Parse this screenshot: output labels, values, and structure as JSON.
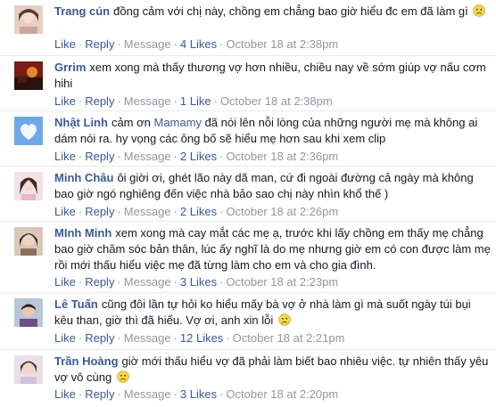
{
  "actions": {
    "like": "Like",
    "reply": "Reply",
    "message": "Message",
    "sep": "·"
  },
  "comments": [
    {
      "author": "Trang cún",
      "text": "đồng cảm với chị này, chồng em chẳng bao giờ hiểu đc em đã làm gì",
      "emoji": "sad-face-emoji",
      "likes": "4 Likes",
      "time": "October 18 at 2:38pm",
      "avatar": "avatar-photo"
    },
    {
      "author": "Grrim",
      "text": "xem xong mà thấy thương vợ hơn nhiều, chiều nay về sớm giúp vợ nấu cơm hihi",
      "likes": "1 Like",
      "time": "October 18 at 2:38pm",
      "avatar": "avatar-photo"
    },
    {
      "author": "Nhật Linh",
      "text_before": "cảm ơn",
      "mention": "Mamamy",
      "text_after": "đã nói lên nỗi lòng của những người mẹ mà không ai dám nói ra. hy vọng các ông bố sẽ hiểu mẹ hơn sau khi xem clip",
      "likes": "2 Likes",
      "time": "October 18 at 2:36pm",
      "avatar": "cloud-heart-avatar"
    },
    {
      "author": "Minh Châu",
      "text": "ôi giời ơi, ghét lão này dã man, cứ đi ngoài đường cả ngày mà không bao giờ ngó nghiêng đến việc nhà bảo sao chị này nhìn khổ thế )",
      "likes": "2 Likes",
      "time": "October 18 at 2:26pm",
      "avatar": "avatar-photo"
    },
    {
      "author": "MInh Minh",
      "text": "xem xong mà cay mắt các mẹ ạ, trước khi lấy chồng em thấy mẹ chẳng bao giờ chăm sóc bản thân, lúc ấy nghĩ là do mẹ nhưng giờ em có con được làm mẹ rồi mới thấu hiểu việc mẹ đã từng làm cho em và cho gia đình.",
      "likes": "3 Likes",
      "time": "October 18 at 2:23pm",
      "avatar": "avatar-photo"
    },
    {
      "author": "Lê Tuấn",
      "text": "cũng đôi lần tự hỏi ko hiểu mấy bà vợ ở nhà làm gì mà suốt ngày túi bụi kêu than, giờ thì đã hiểu. Vợ ơi, anh xin lỗi",
      "emoji": "sad-face-emoji",
      "likes": "12 Likes",
      "time": "October 18 at 2:21pm",
      "avatar": "avatar-photo"
    },
    {
      "author": "Trần Hoàng",
      "text": "giờ mới thấu hiểu vợ đã phải làm biết bao nhiêu việc. tự nhiên thấy yêu vợ vô cùng",
      "emoji": "sad-face-emoji",
      "likes": "3 Likes",
      "time": "October 18 at 2:20pm",
      "avatar": "avatar-photo"
    }
  ]
}
